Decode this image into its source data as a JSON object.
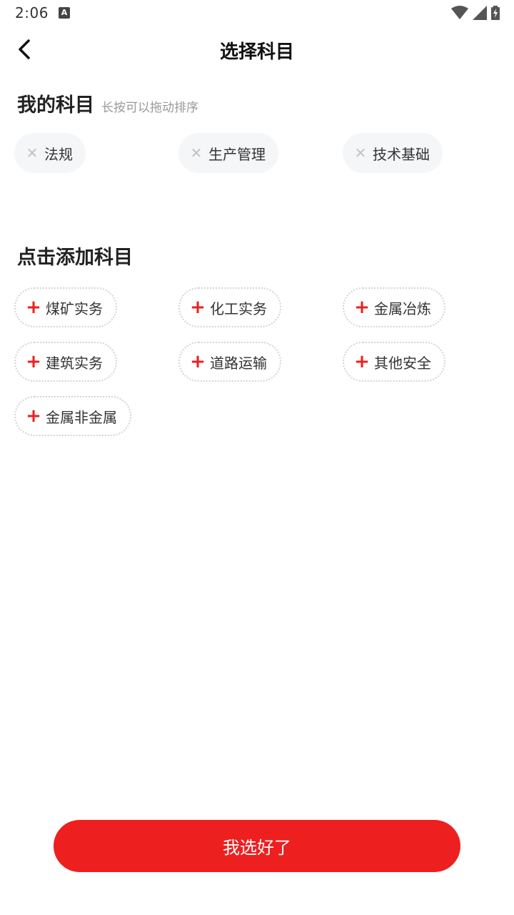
{
  "status_bar": {
    "time": "2:06",
    "notification_icon": "a-square-icon",
    "icons": [
      "wifi-icon",
      "cellular-signal-icon",
      "battery-charging-icon"
    ]
  },
  "header": {
    "title": "选择科目",
    "back_icon": "chevron-left-icon"
  },
  "my_subjects": {
    "title": "我的科目",
    "hint": "长按可以拖动排序",
    "items": [
      "法规",
      "生产管理",
      "技术基础"
    ]
  },
  "add_subjects": {
    "title": "点击添加科目",
    "items": [
      "煤矿实务",
      "化工实务",
      "金属冶炼",
      "建筑实务",
      "道路运输",
      "其他安全",
      "金属非金属"
    ]
  },
  "footer": {
    "confirm_label": "我选好了"
  },
  "colors": {
    "accent": "#ee1f1f",
    "chip_bg": "#f5f6f8",
    "hint": "#999999"
  }
}
